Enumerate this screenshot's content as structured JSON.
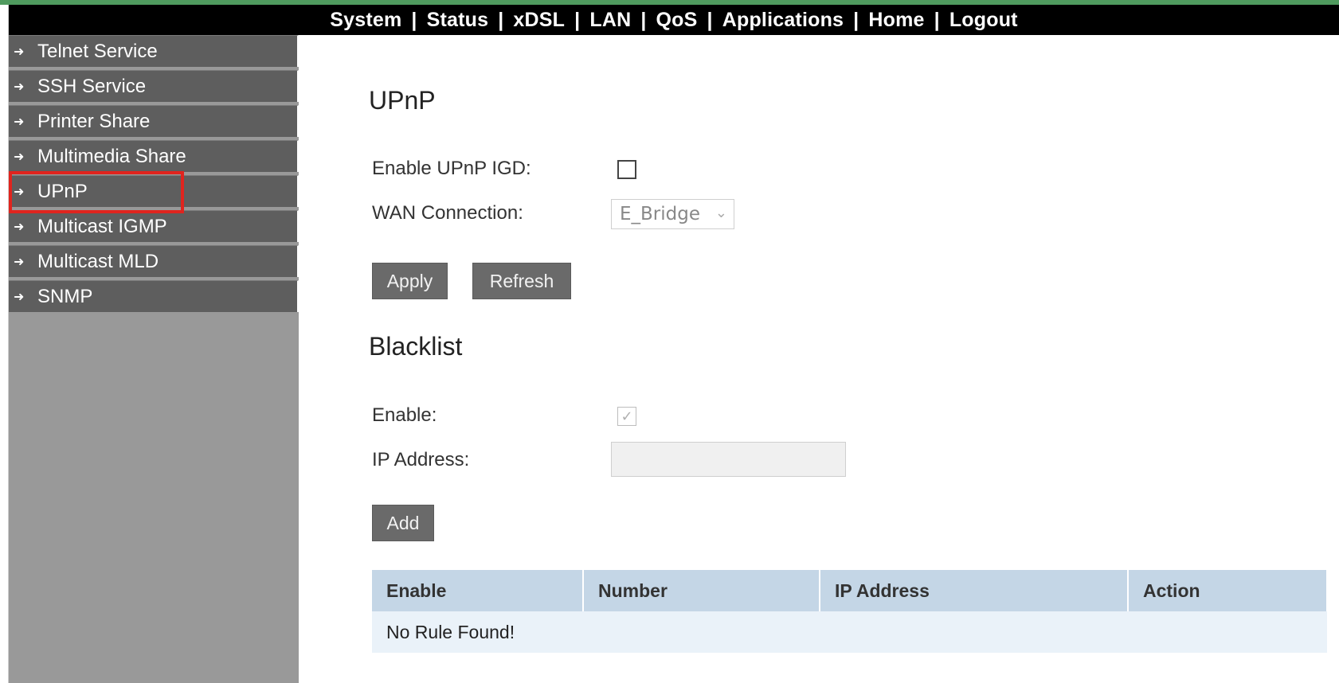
{
  "topnav": {
    "items": [
      "System",
      "Status",
      "xDSL",
      "LAN",
      "QoS",
      "Applications",
      "Home",
      "Logout"
    ],
    "separator": "|"
  },
  "sidebar": {
    "items": [
      {
        "label": "Telnet Service"
      },
      {
        "label": "SSH Service"
      },
      {
        "label": "Printer Share"
      },
      {
        "label": "Multimedia Share"
      },
      {
        "label": "UPnP",
        "highlighted": true
      },
      {
        "label": "Multicast IGMP"
      },
      {
        "label": "Multicast MLD"
      },
      {
        "label": "SNMP"
      }
    ]
  },
  "upnp": {
    "title": "UPnP",
    "enable_label": "Enable UPnP IGD:",
    "enable_checked": false,
    "wan_label": "WAN Connection:",
    "wan_value": "E_Bridge",
    "apply_label": "Apply",
    "refresh_label": "Refresh"
  },
  "blacklist": {
    "title": "Blacklist",
    "enable_label": "Enable:",
    "enable_checked": true,
    "enable_disabled": true,
    "ip_label": "IP Address:",
    "ip_value": "",
    "add_label": "Add",
    "table": {
      "headers": [
        "Enable",
        "Number",
        "IP Address",
        "Action"
      ],
      "empty_message": "No Rule Found!"
    }
  },
  "colors": {
    "topbar": "#000000",
    "sidebar_item": "#5e5e5e",
    "sidebar_bg": "#999999",
    "highlight": "#e0241e",
    "table_header": "#c4d6e6",
    "table_row": "#eaf2f9"
  }
}
